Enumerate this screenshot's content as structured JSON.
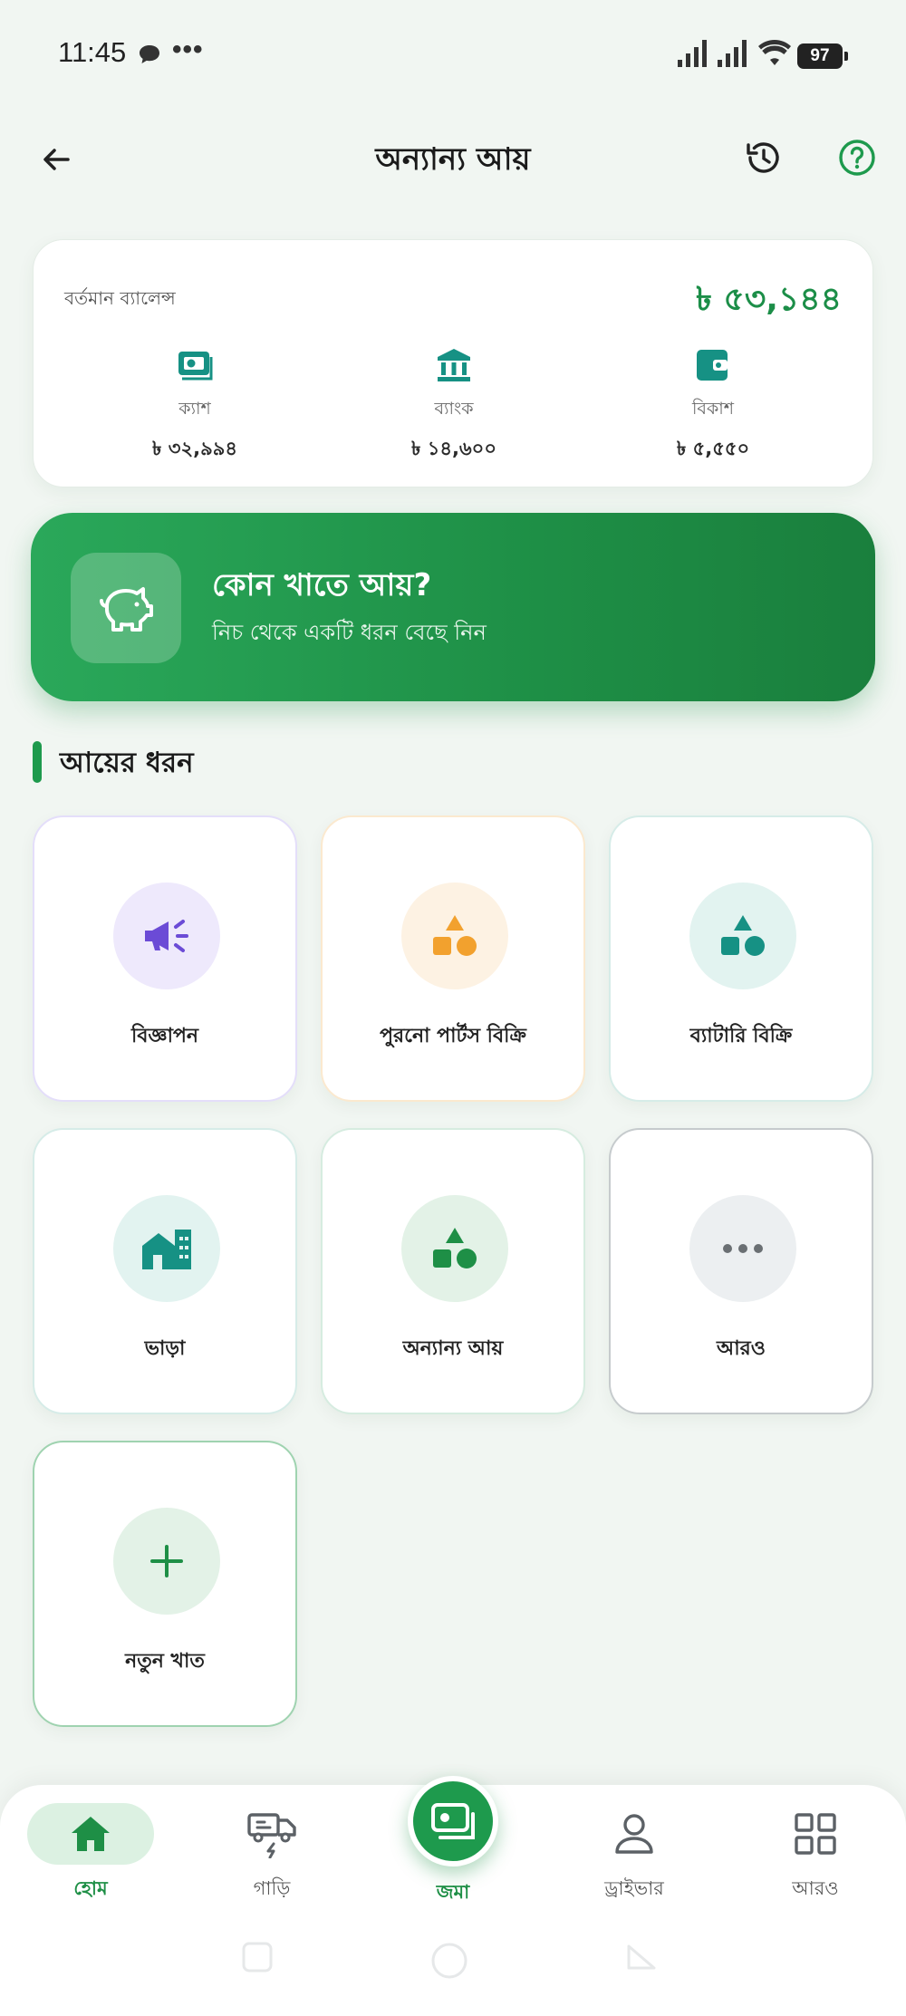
{
  "status": {
    "time": "11:45",
    "dots": "•••",
    "battery": "97"
  },
  "header": {
    "title": "অন্যান্য আয়"
  },
  "balance": {
    "label": "বর্তমান ব্যালেন্স",
    "amount": "৳ ৫৩,১৪৪",
    "accounts": [
      {
        "label": "ক্যাশ",
        "value": "৳ ৩২,৯৯৪",
        "icon": "cash-icon"
      },
      {
        "label": "ব্যাংক",
        "value": "৳ ১৪,৬০০",
        "icon": "bank-icon"
      },
      {
        "label": "বিকাশ",
        "value": "৳ ৫,৫৫০",
        "icon": "wallet-icon"
      }
    ]
  },
  "promo": {
    "title": "কোন খাতে আয়?",
    "subtitle": "নিচ থেকে একটি ধরন বেছে নিন",
    "icon": "piggy-bank-icon"
  },
  "section": {
    "title": "আয়ের ধরন"
  },
  "categories": [
    {
      "label": "বিজ্ঞাপন",
      "icon": "megaphone-icon",
      "color": "#6b4bd6",
      "bg": "#eee9fc",
      "border": "#e4defa"
    },
    {
      "label": "পুরনো পার্টস বিক্রি",
      "icon": "shapes-icon",
      "color": "#f2a12e",
      "bg": "#fdf2e3",
      "border": "#fbe9cf"
    },
    {
      "label": "ব্যাটারি বিক্রি",
      "icon": "shapes-icon",
      "color": "#169184",
      "bg": "#e2f3f0",
      "border": "#d6ece8"
    },
    {
      "label": "ভাড়া",
      "icon": "building-icon",
      "color": "#169184",
      "bg": "#e2f3f0",
      "border": "#d6ece8"
    },
    {
      "label": "অন্যান্য আয়",
      "icon": "shapes-icon",
      "color": "#1e8f46",
      "bg": "#e3f2e7",
      "border": "#d6ece0"
    },
    {
      "label": "আরও",
      "icon": "more-dots-icon",
      "color": "#6a6f73",
      "bg": "#eceff1",
      "border": "#c6cbcd"
    },
    {
      "label": "নতুন খাত",
      "icon": "plus-icon",
      "color": "#1e8f46",
      "bg": "#e3f2e7",
      "border": "#9fd3b0"
    }
  ],
  "nav": {
    "items": [
      {
        "label": "হোম",
        "icon": "home-icon"
      },
      {
        "label": "গাড়ি",
        "icon": "truck-icon"
      },
      {
        "label": "জমা",
        "icon": "cash-icon"
      },
      {
        "label": "ড্রাইভার",
        "icon": "person-icon"
      },
      {
        "label": "আরও",
        "icon": "grid-icon"
      }
    ]
  },
  "colors": {
    "accent": "#1e9a4d",
    "background": "#f1f6f2"
  }
}
